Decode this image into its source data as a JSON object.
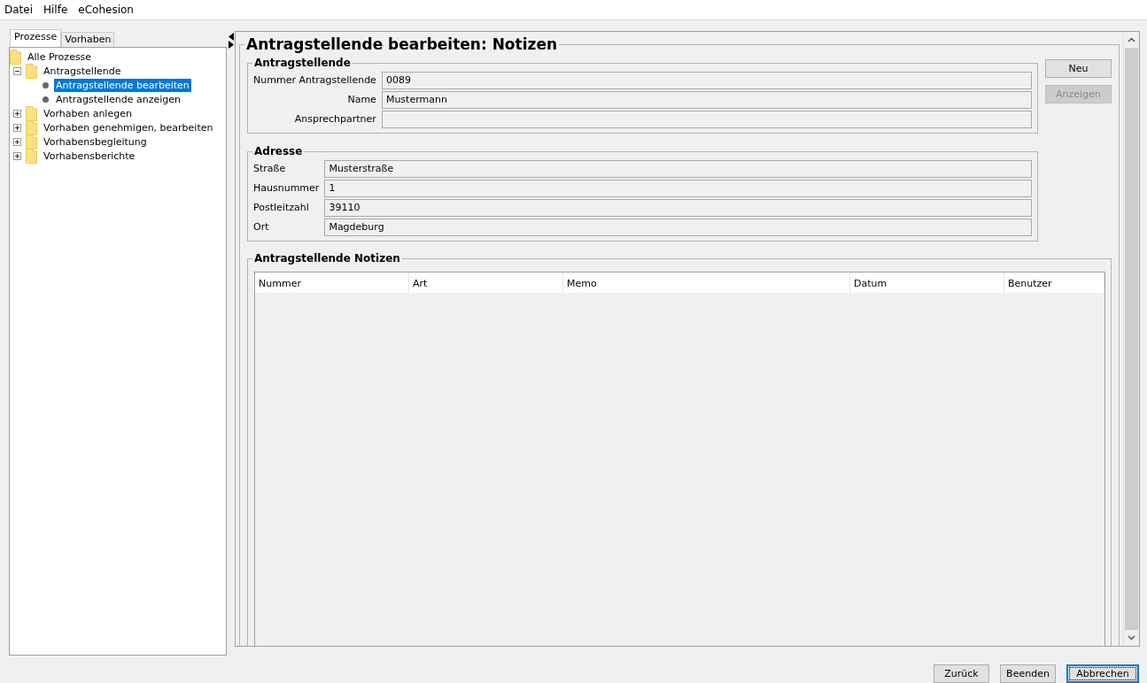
{
  "menu": [
    "Datei",
    "Hilfe",
    "eCohesion"
  ],
  "tabs": [
    {
      "label": "Prozesse",
      "selected": true
    },
    {
      "label": "Vorhaben",
      "selected": false
    }
  ],
  "tree": [
    {
      "label": "Alle Prozesse",
      "kind": "folder",
      "selected": false,
      "children": [
        {
          "label": "Antragstellende",
          "kind": "folder",
          "expanded": true,
          "selected": false,
          "children": [
            {
              "label": "Antragstellende bearbeiten",
              "kind": "item",
              "selected": true
            },
            {
              "label": "Antragstellende anzeigen",
              "kind": "item",
              "selected": false
            }
          ]
        },
        {
          "label": "Vorhaben anlegen",
          "kind": "folder",
          "expanded": false,
          "selected": false
        },
        {
          "label": "Vorhaben genehmigen, bearbeiten",
          "kind": "folder",
          "expanded": false,
          "selected": false
        },
        {
          "label": "Vorhabensbegleitung",
          "kind": "folder",
          "expanded": false,
          "selected": false
        },
        {
          "label": "Vorhabensberichte",
          "kind": "folder",
          "expanded": false,
          "selected": false
        }
      ]
    }
  ],
  "form": {
    "title": "Antragstellende bearbeiten: Notizen",
    "groups": [
      {
        "title": "Antragstellende",
        "kind": "aligned",
        "fields": [
          {
            "label": "Nummer Antragstellende",
            "value": "0089"
          },
          {
            "label": "Name",
            "value": "Mustermann"
          },
          {
            "label": "Ansprechpartner"
          }
        ]
      },
      {
        "title": "Adresse",
        "kind": "plain",
        "fields": [
          {
            "label": "Straße",
            "value": "Musterstraße"
          },
          {
            "label": "Hausnummer",
            "value": "1"
          },
          {
            "label": "Postleitzahl",
            "value": "39110"
          },
          {
            "label": "Ort",
            "value": "Magdeburg"
          }
        ]
      }
    ],
    "side_buttons": [
      {
        "label": "Neu",
        "disabled": false
      },
      {
        "label": "Anzeigen",
        "disabled": true
      }
    ],
    "notes": {
      "title": "Antragstellende Notizen",
      "columns": [
        "Nummer",
        "Art",
        "Memo",
        "Datum",
        "Benutzer"
      ]
    }
  },
  "buttons": [
    {
      "label": "Zurück",
      "focused": false
    },
    {
      "label": "Beenden",
      "focused": false
    },
    {
      "label": "Abbrechen",
      "focused": true
    }
  ]
}
